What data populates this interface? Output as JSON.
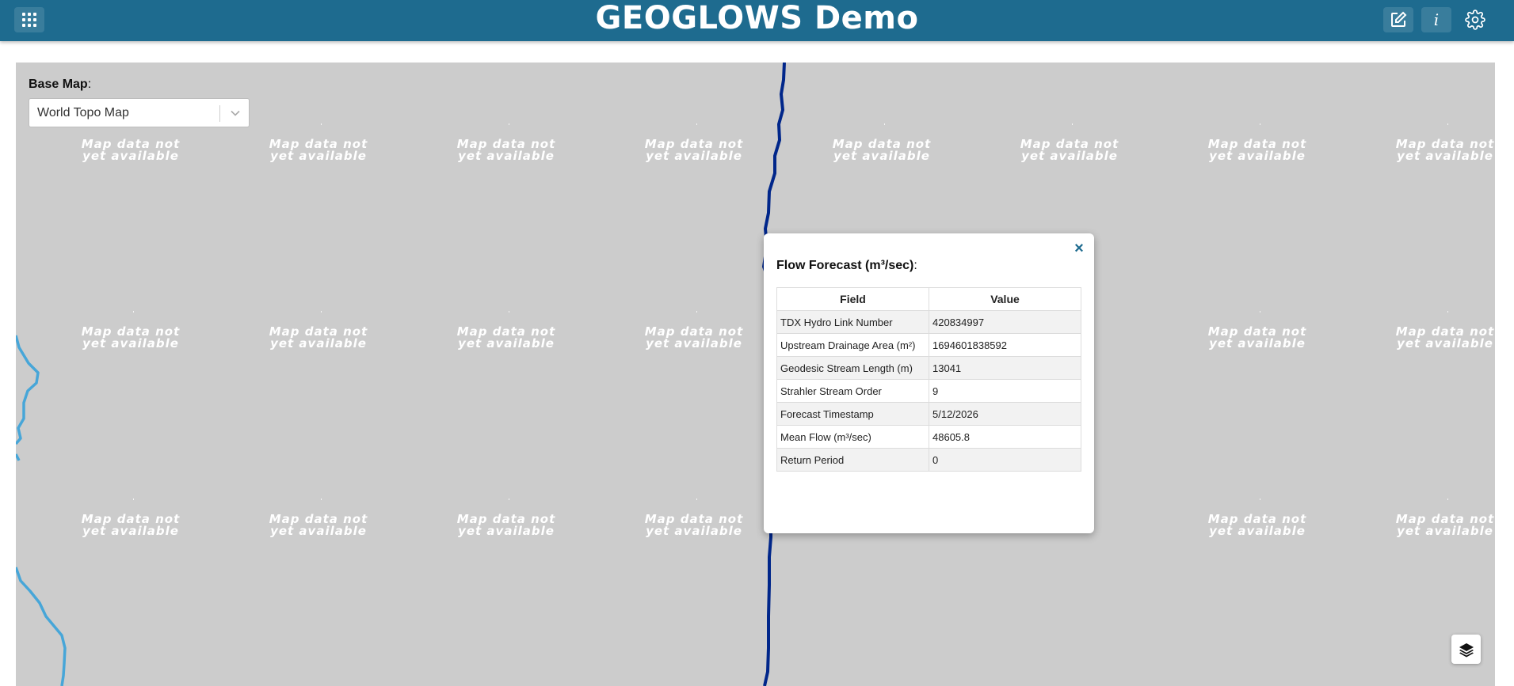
{
  "app": {
    "title": "GEOGLOWS Demo",
    "accent_color": "#1e6b8f"
  },
  "header_buttons": {
    "apps_icon": "grid-icon",
    "edit_icon": "edit-icon",
    "info_label": "i",
    "settings_icon": "gear-icon"
  },
  "basemap": {
    "label": "Base Map",
    "label_suffix": ":",
    "selected": "World Topo Map"
  },
  "map": {
    "tile_line1": "Map data not",
    "tile_line2": "yet available",
    "background_color": "#cccccc",
    "main_river_color": "#00268a",
    "tributary_color": "#47a6d8"
  },
  "popup": {
    "title_main": "Flow Forecast (m³/sec)",
    "title_suffix": ":",
    "close_label": "×",
    "header_field": "Field",
    "header_value": "Value",
    "rows": [
      {
        "field": "TDX Hydro Link Number",
        "value": "420834997"
      },
      {
        "field": "Upstream Drainage Area (m²)",
        "value": "1694601838592"
      },
      {
        "field": "Geodesic Stream Length (m)",
        "value": "13041"
      },
      {
        "field": "Strahler Stream Order",
        "value": "9"
      },
      {
        "field": "Forecast Timestamp",
        "value": "5/12/2026"
      },
      {
        "field": "Mean Flow (m³/sec)",
        "value": "48605.8"
      },
      {
        "field": "Return Period",
        "value": "0"
      }
    ]
  },
  "layers_icon": "layers-icon"
}
